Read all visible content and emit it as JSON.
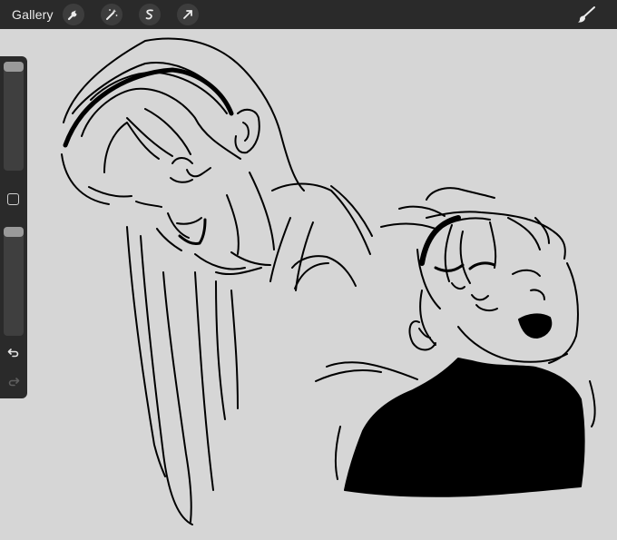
{
  "app": {
    "gallery_label": "Gallery"
  },
  "toolbar": {
    "actions_icon": "wrench-icon",
    "adjustments_icon": "magic-wand-icon",
    "selection_icon": "selection-s-icon",
    "transform_icon": "arrow-cursor-icon",
    "brush_icon": "paintbrush-icon"
  },
  "sidebar": {
    "brush_size_level": 0,
    "opacity_level": 0,
    "modify_icon": "square-icon",
    "undo_icon": "undo-icon",
    "redo_icon": "redo-icon",
    "redo_enabled": false
  },
  "canvas": {
    "description_free": true,
    "background_color": "#d6d6d6",
    "ink_color": "#000000"
  },
  "colors": {
    "toolbar_bg": "#2a2a2a",
    "icon_fg": "#ececec"
  }
}
